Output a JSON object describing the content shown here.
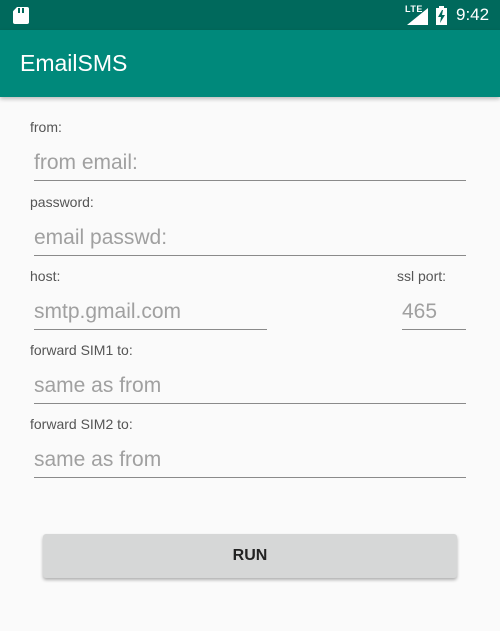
{
  "status_bar": {
    "time": "9:42",
    "network": "LTE",
    "icons": [
      "sd-card-icon",
      "signal-icon",
      "battery-charging-icon"
    ]
  },
  "app_bar": {
    "title": "EmailSMS"
  },
  "form": {
    "from_label": "from:",
    "from_placeholder": "from email:",
    "password_label": "password:",
    "password_placeholder": "email passwd:",
    "host_label": "host:",
    "host_placeholder": "smtp.gmail.com",
    "ssl_port_label": "ssl port:",
    "ssl_port_placeholder": "465",
    "sim1_label": "forward SIM1 to:",
    "sim1_placeholder": "same as from",
    "sim2_label": "forward SIM2 to:",
    "sim2_placeholder": "same as from"
  },
  "run_button": {
    "label": "RUN"
  },
  "colors": {
    "status_bar": "#00695c",
    "app_bar": "#00897b",
    "background": "#fafafa",
    "button": "#d6d7d7"
  }
}
